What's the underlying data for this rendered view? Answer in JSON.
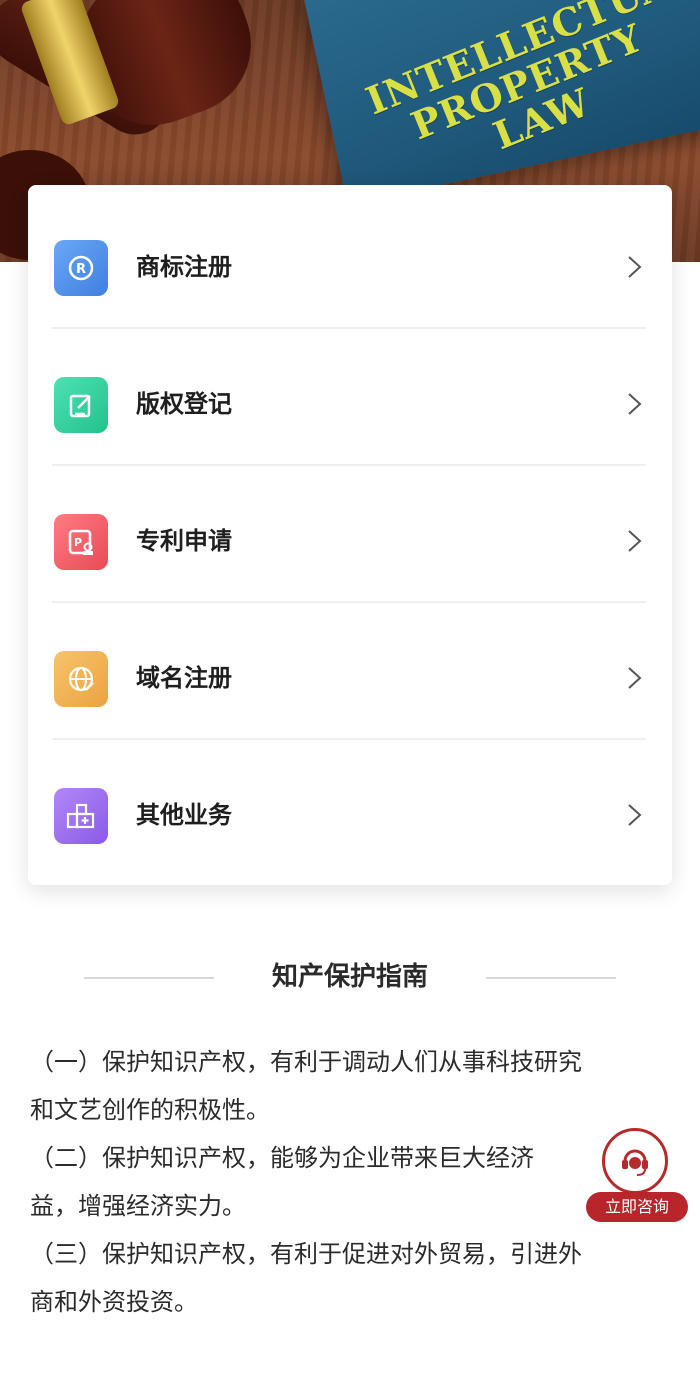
{
  "hero": {
    "book_title_lines": [
      "INTELLECTUAL",
      "PROPERTY",
      "LAW"
    ]
  },
  "menu": {
    "items": [
      {
        "label": "商标注册",
        "icon": "trademark-icon",
        "color": "#4f8fe6"
      },
      {
        "label": "版权登记",
        "icon": "edit-icon",
        "color": "#2fcf9a"
      },
      {
        "label": "专利申请",
        "icon": "patent-icon",
        "color": "#ef5b66"
      },
      {
        "label": "域名注册",
        "icon": "globe-icon",
        "color": "#f0b24e"
      },
      {
        "label": "其他业务",
        "icon": "add-grid-icon",
        "color": "#9b6cf0"
      }
    ]
  },
  "guide": {
    "title": "知产保护指南",
    "paragraphs": [
      {
        "line1": "（一）保护知识产权，有利于调动人们从事科技研究",
        "line2": "和文艺创作的积极性。"
      },
      {
        "line1": "（二）保护知识产权，能够为企业带来巨大经济",
        "line2": "益，增强经济实力。"
      },
      {
        "line1": "（三）保护知识产权，有利于促进对外贸易，引进外",
        "line2": "商和外资投资。"
      }
    ]
  },
  "consult": {
    "label": "立即咨询",
    "color": "#b8262c"
  }
}
